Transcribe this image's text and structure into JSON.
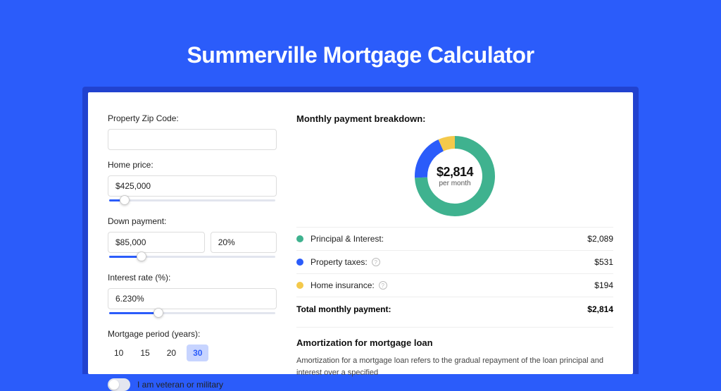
{
  "title": "Summerville Mortgage Calculator",
  "left": {
    "zip_label": "Property Zip Code:",
    "zip_value": "",
    "home_price_label": "Home price:",
    "home_price_value": "$425,000",
    "home_price_slider_pct": 10,
    "down_payment_label": "Down payment:",
    "down_payment_value": "$85,000",
    "down_payment_pct": "20%",
    "down_payment_slider_pct": 20,
    "interest_label": "Interest rate (%):",
    "interest_value": "6.230%",
    "interest_slider_pct": 30,
    "period_label": "Mortgage period (years):",
    "periods": [
      "10",
      "15",
      "20",
      "30"
    ],
    "period_active_index": 3,
    "veteran_label": "I am veteran or military",
    "veteran_on": false
  },
  "right": {
    "breakdown_title": "Monthly payment breakdown:",
    "donut_amount": "$2,814",
    "donut_sub": "per month",
    "legend": [
      {
        "label": "Principal & Interest:",
        "value": "$2,089",
        "color": "#3fb28f",
        "info": false,
        "share": 0.742
      },
      {
        "label": "Property taxes:",
        "value": "$531",
        "color": "#2b5cfa",
        "info": true,
        "share": 0.189
      },
      {
        "label": "Home insurance:",
        "value": "$194",
        "color": "#f4c94b",
        "info": true,
        "share": 0.069
      }
    ],
    "total_label": "Total monthly payment:",
    "total_value": "$2,814",
    "amort_title": "Amortization for mortgage loan",
    "amort_body": "Amortization for a mortgage loan refers to the gradual repayment of the loan principal and interest over a specified"
  },
  "chart_data": {
    "type": "pie",
    "title": "Monthly payment breakdown",
    "series": [
      {
        "name": "Principal & Interest",
        "value": 2089,
        "color": "#3fb28f"
      },
      {
        "name": "Property taxes",
        "value": 531,
        "color": "#2b5cfa"
      },
      {
        "name": "Home insurance",
        "value": 194,
        "color": "#f4c94b"
      }
    ],
    "total": 2814,
    "center_label": "$2,814 per month"
  }
}
